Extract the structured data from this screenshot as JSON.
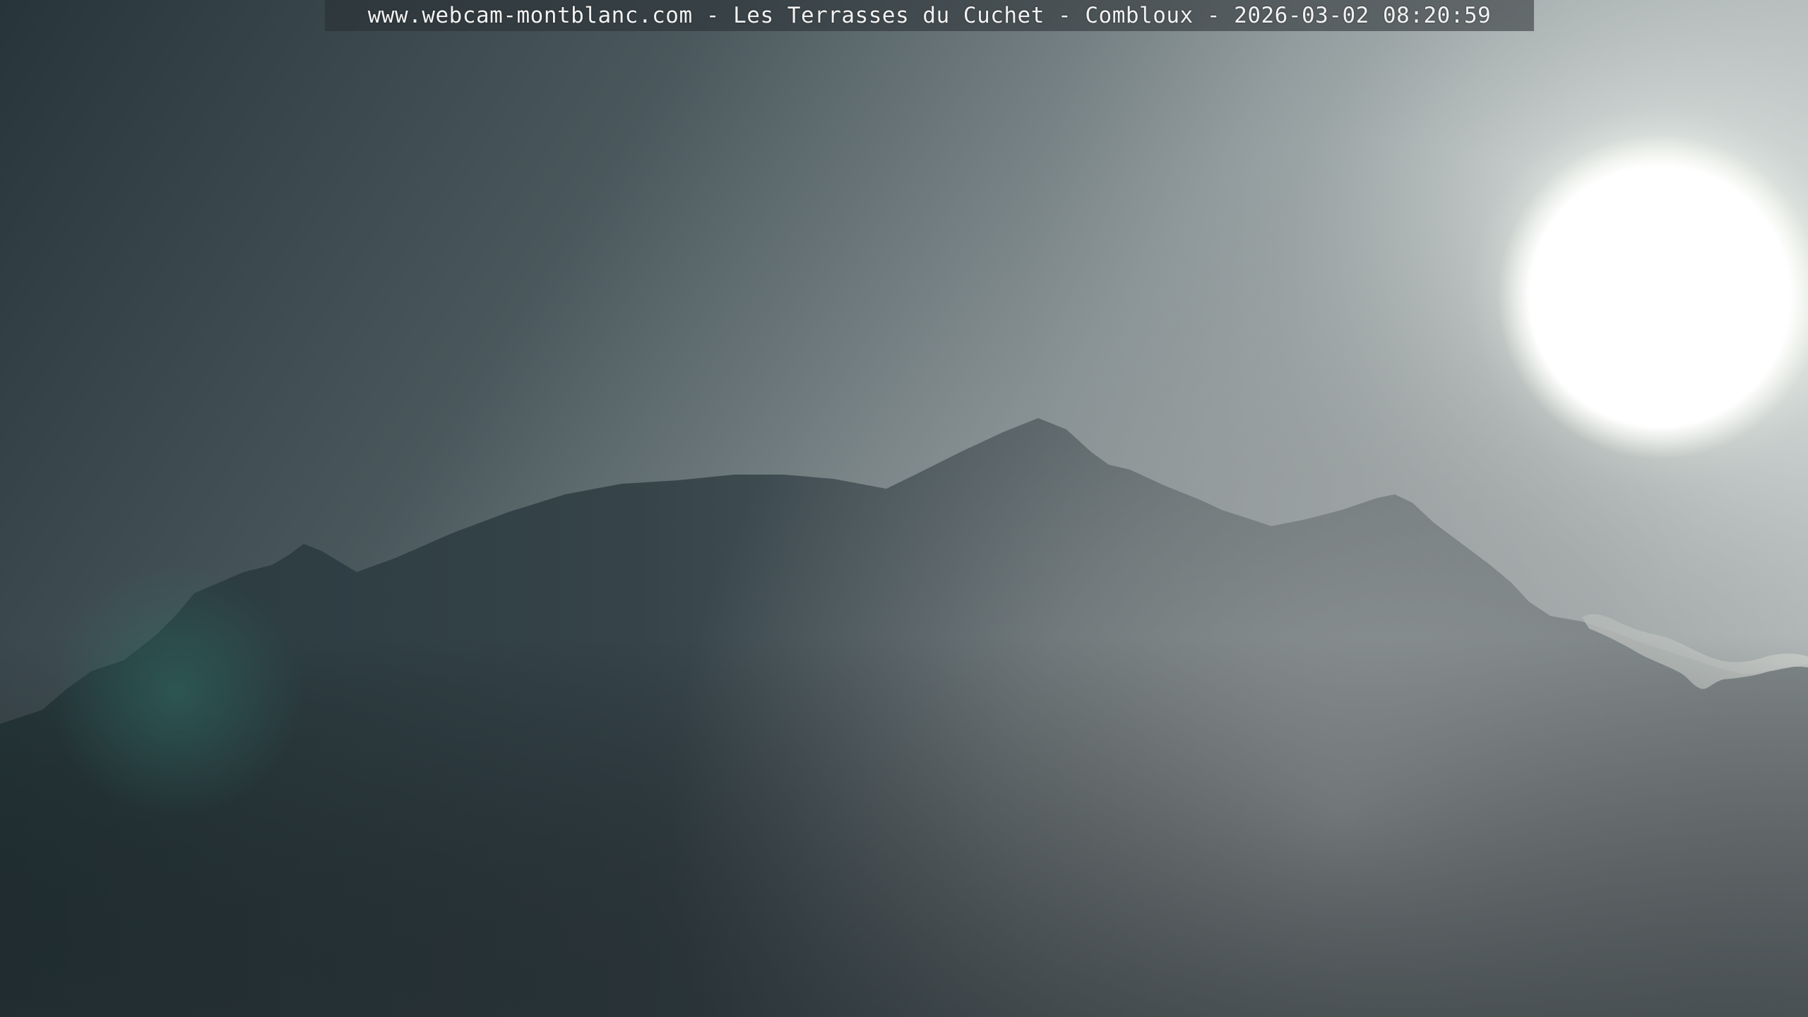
{
  "webcam": {
    "caption": "www.webcam-montblanc.com - Les Terrasses du Cuchet - Combloux - 2026-03-02 08:20:59"
  },
  "scene": {
    "sky_color_dark": "#2c3a40",
    "sky_color_light": "#aeb6b8",
    "mountain_color": "#3a444a",
    "fog_color": "#8e9496",
    "sun_color": "#ffffff"
  }
}
